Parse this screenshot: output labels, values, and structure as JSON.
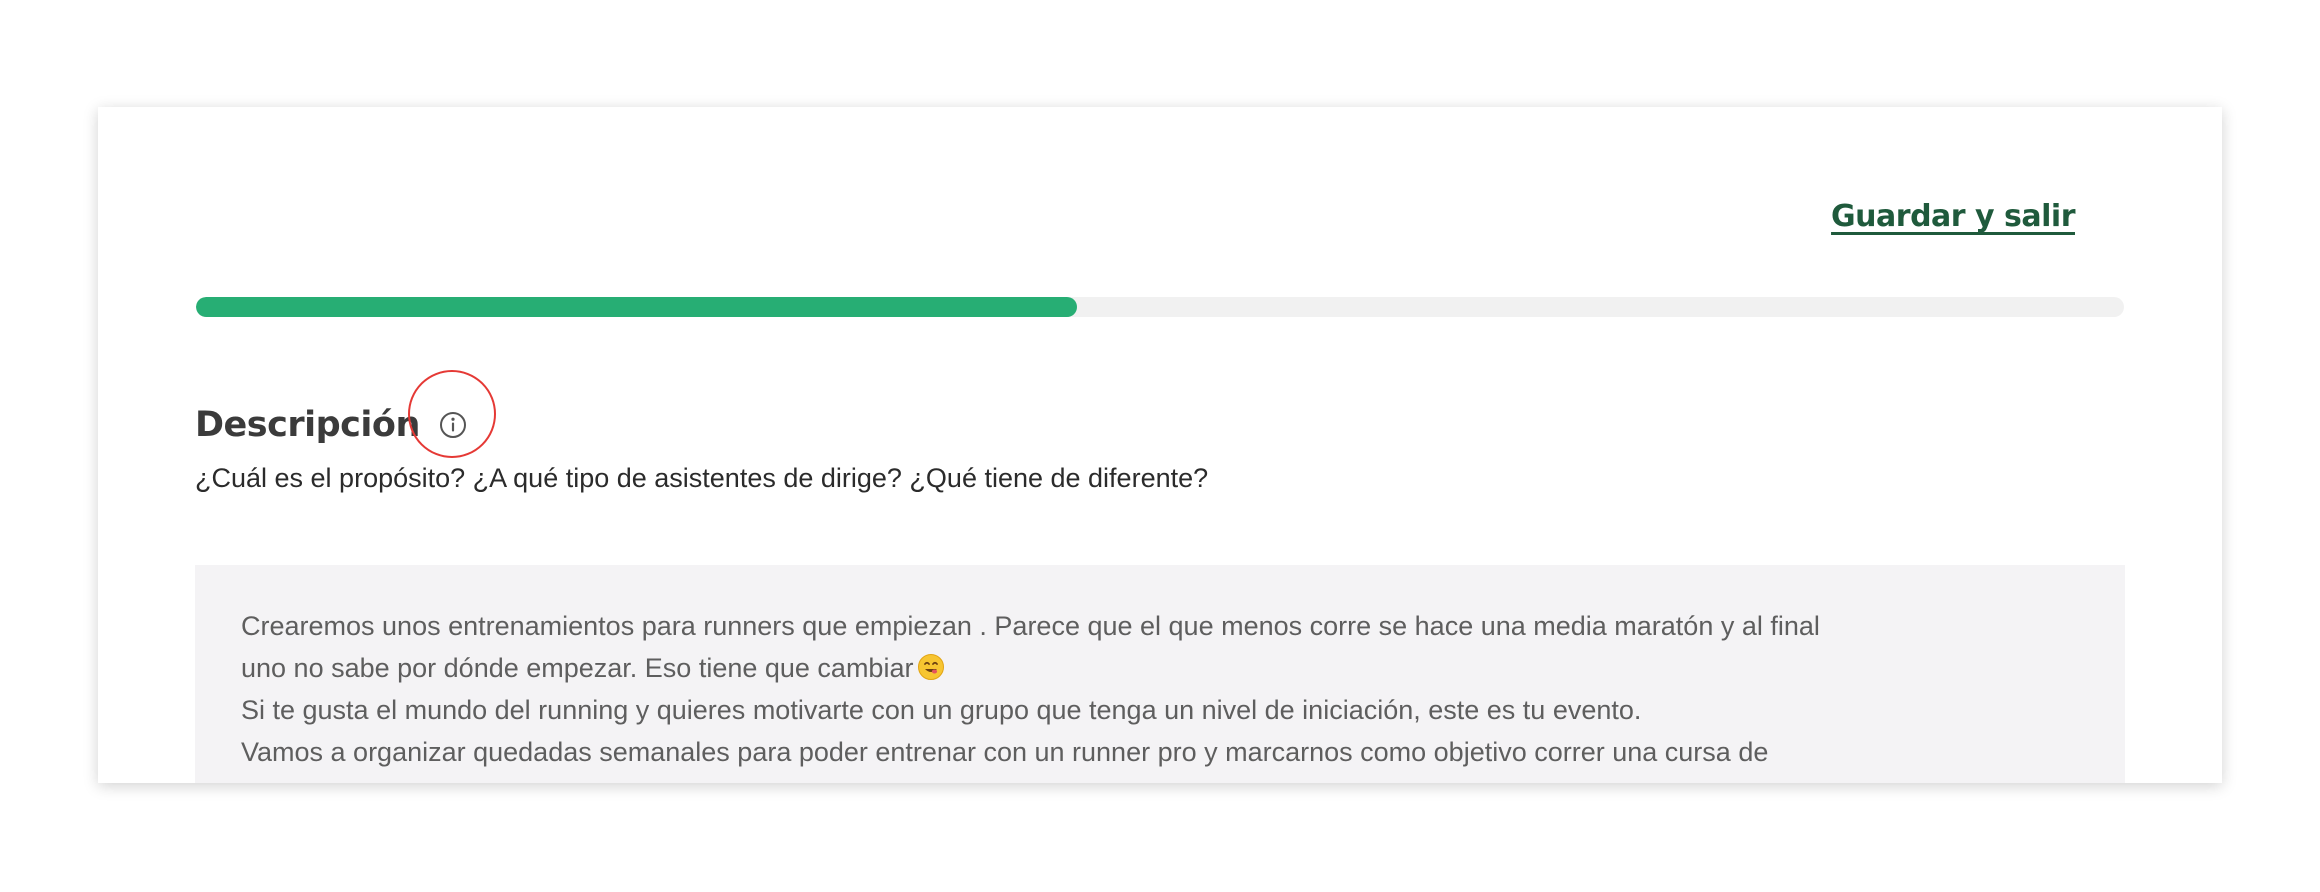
{
  "header": {
    "save_exit_label": "Guardar y salir"
  },
  "progress": {
    "fraction": 0.457,
    "fill_color": "#27ae74",
    "track_color": "#f1f1f1"
  },
  "section": {
    "title": "Descripción",
    "info_icon": "info-circle-icon",
    "subtitle": "¿Cuál es el propósito? ¿A qué tipo de asistentes de dirige? ¿Qué tiene de diferente?"
  },
  "description": {
    "lines": [
      "Crearemos unos entrenamientos para runners que empiezan . Parece que el que menos corre se hace una media maratón y al final",
      "uno no sabe por dónde empezar. Eso tiene que cambiar",
      "Si te gusta el mundo del running y quieres motivarte con un grupo que tenga un nivel de iniciación, este es tu evento.",
      "Vamos a organizar quedadas semanales para poder entrenar con un runner pro y marcarnos como objetivo correr una cursa de"
    ],
    "emoji": "face-savoring-food-emoji"
  },
  "colors": {
    "brand_dark_green": "#1f5a3c",
    "highlight_red": "#e53935"
  }
}
